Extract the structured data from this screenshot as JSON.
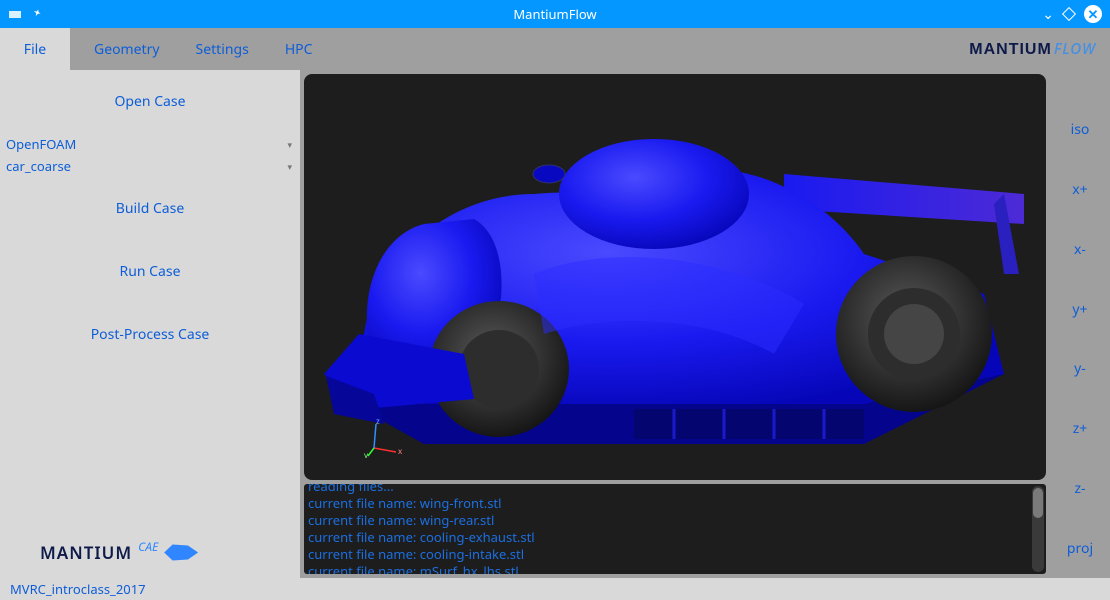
{
  "window": {
    "title": "MantiumFlow"
  },
  "menu": {
    "file": "File",
    "geometry": "Geometry",
    "settings": "Settings",
    "hpc": "HPC"
  },
  "brand": {
    "name": "MANTIUM",
    "suffix": "FLOW",
    "cae": "CAE"
  },
  "left_panel": {
    "open_case": "Open Case",
    "dropdown1": "OpenFOAM",
    "dropdown2": "car_coarse",
    "build_case": "Build Case",
    "run_case": "Run Case",
    "post_process": "Post-Process Case"
  },
  "axis": {
    "x": "x",
    "y": "y",
    "z": "z"
  },
  "console": {
    "lines": [
      "reading files...",
      "current file name: wing-front.stl",
      "current file name: wing-rear.stl",
      "current file name: cooling-exhaust.stl",
      "current file name: cooling-intake.stl",
      "current file name: mSurf_hx_lhs.stl"
    ]
  },
  "views": {
    "iso": "iso",
    "xp": "x+",
    "xm": "x-",
    "yp": "y+",
    "ym": "y-",
    "zp": "z+",
    "zm": "z-",
    "proj": "proj"
  },
  "status": {
    "text": "MVRC_introclass_2017"
  }
}
